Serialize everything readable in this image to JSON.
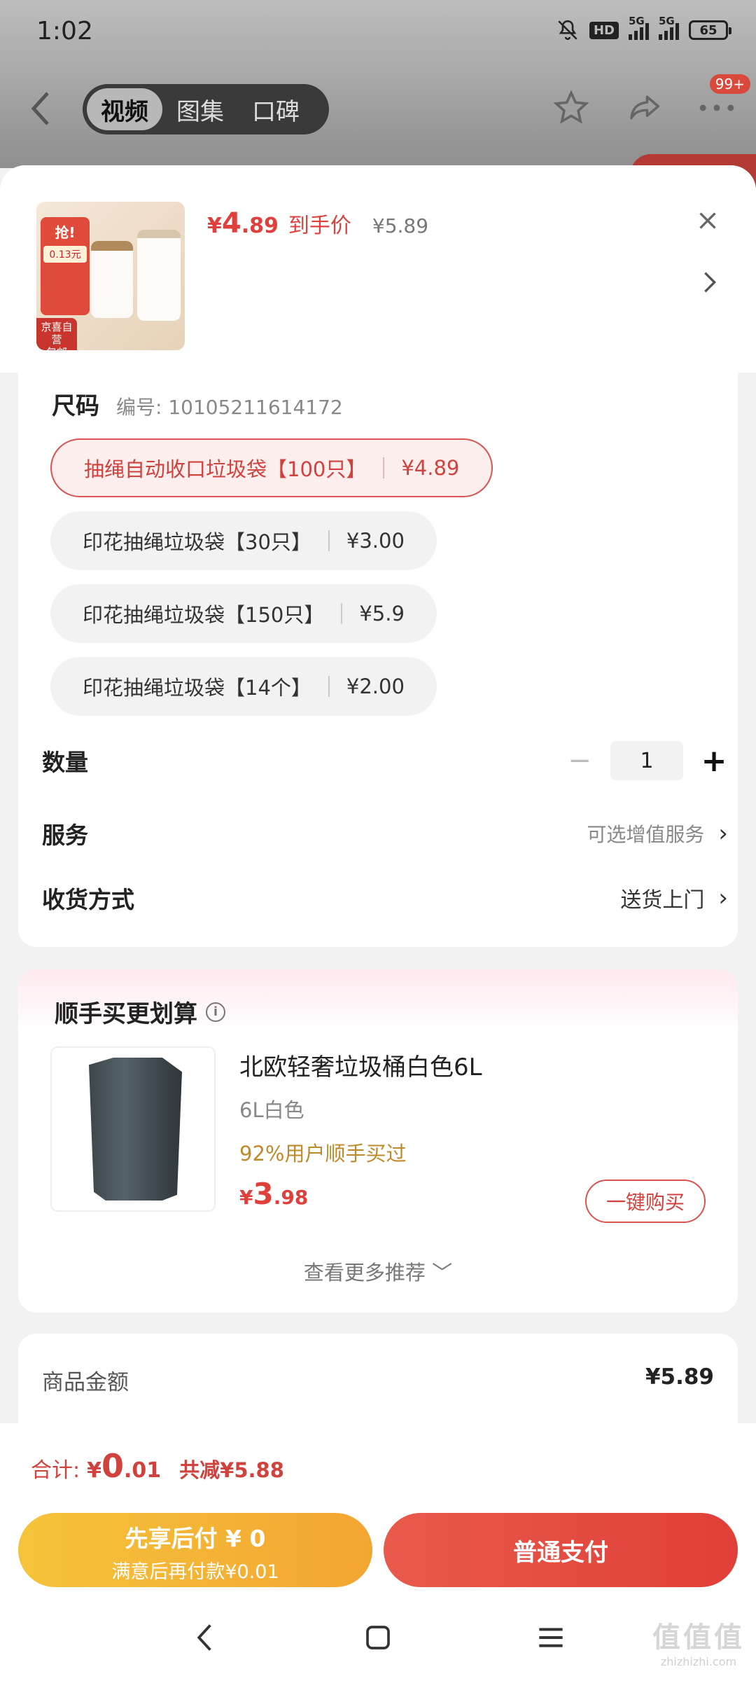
{
  "status_bar": {
    "time": "1:02",
    "hd_label": "HD",
    "net1": "5G",
    "net2": "5G",
    "battery": "65"
  },
  "top_nav": {
    "tabs": [
      {
        "label": "视频",
        "active": true
      },
      {
        "label": "图集",
        "active": false
      },
      {
        "label": "口碑",
        "active": false
      }
    ],
    "badge": "99+"
  },
  "product": {
    "thumb_tag": "抢!",
    "thumb_tag_sub": "0.13元",
    "thumb_ship": "京喜自营\n包邮",
    "price_symbol": "¥",
    "price_int": "4",
    "price_dec": ".89",
    "price_label": "到手价",
    "original_price": "¥5.89"
  },
  "spec": {
    "title": "尺码",
    "code": "编号: 10105211614172",
    "options": [
      {
        "name": "抽绳自动收口垃圾袋【100只】",
        "price": "¥4.89",
        "selected": true
      },
      {
        "name": "印花抽绳垃圾袋【30只】",
        "price": "¥3.00",
        "selected": false
      },
      {
        "name": "印花抽绳垃圾袋【150只】",
        "price": "¥5.9",
        "selected": false
      },
      {
        "name": "印花抽绳垃圾袋【14个】",
        "price": "¥2.00",
        "selected": false
      }
    ]
  },
  "quantity": {
    "label": "数量",
    "value": "1",
    "minus": "−",
    "plus": "+"
  },
  "service": {
    "label": "服务",
    "value": "可选增值服务"
  },
  "delivery": {
    "label": "收货方式",
    "value": "送货上门"
  },
  "recommend": {
    "title": "顺手买更划算",
    "item_name": "北欧轻奢垃圾桶白色6L",
    "item_spec": "6L白色",
    "item_hint": "92%用户顺手买过",
    "price_symbol": "¥",
    "price_int": "3",
    "price_dec": ".98",
    "buy_label": "一键购买",
    "more_label": "查看更多推荐 ﹀"
  },
  "amount": {
    "label": "商品金额",
    "value": "¥5.89"
  },
  "footer": {
    "total_label": "合计:",
    "total_symbol": "¥",
    "total_int": "0",
    "total_dec": ".01",
    "discount": "共减¥5.88",
    "later_line1": "先享后付 ¥ 0",
    "later_line2": "满意后再付款¥0.01",
    "pay_label": "普通支付"
  },
  "watermark": {
    "line1": "值值值",
    "line2": "zhizhizhi.com"
  },
  "colors": {
    "accent": "#e0403b",
    "gold": "#f3a531",
    "hint": "#c08a2c"
  }
}
